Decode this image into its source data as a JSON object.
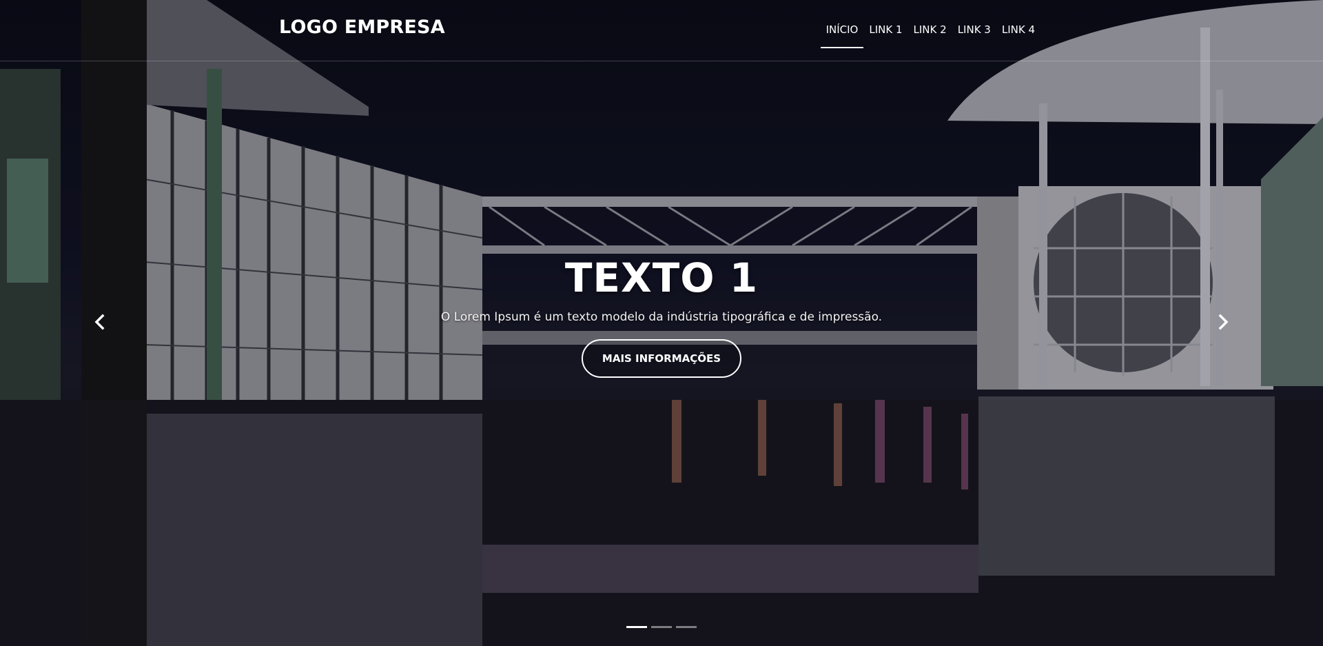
{
  "navbar": {
    "logo": "LOGO EMPRESA",
    "links": [
      "INÍCIO",
      "LINK 1",
      "LINK 2",
      "LINK 3",
      "LINK 4"
    ],
    "active_index": 0
  },
  "slide": {
    "title": "TEXTO 1",
    "description": "O Lorem Ipsum é um texto modelo da indústria tipográfica e de impressão.",
    "button_label": "MAIS INFORMAÇÕES"
  },
  "carousel": {
    "prev_icon": "chevron-left-icon",
    "next_icon": "chevron-right-icon",
    "slide_count": 3,
    "active_slide": 1
  },
  "colors": {
    "text": "#ffffff",
    "background": "#0c0c14"
  }
}
